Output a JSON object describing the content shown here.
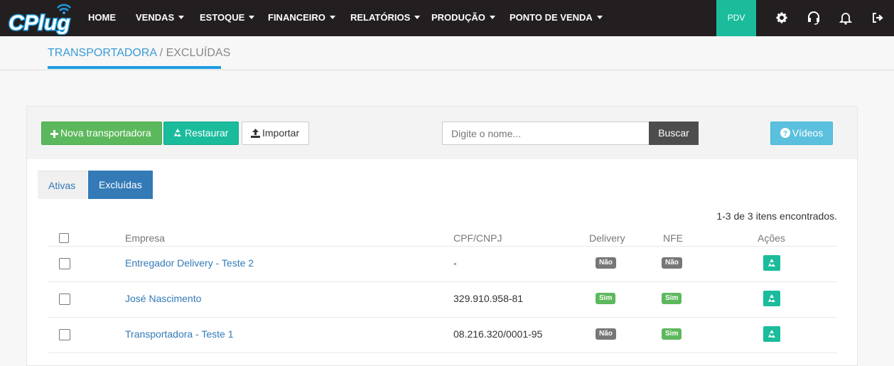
{
  "app": {
    "logo_text": "CPlug"
  },
  "nav": {
    "items": [
      {
        "label": "HOME",
        "dropdown": false
      },
      {
        "label": "VENDAS",
        "dropdown": true
      },
      {
        "label": "ESTOQUE",
        "dropdown": true
      },
      {
        "label": "FINANCEIRO",
        "dropdown": true
      },
      {
        "label": "RELATÓRIOS",
        "dropdown": true
      },
      {
        "label": "PRODUÇÃO",
        "dropdown": true
      },
      {
        "label": "PONTO DE VENDA",
        "dropdown": true
      }
    ],
    "pdv_label": "PDV",
    "icons": [
      "gear-icon",
      "headset-icon",
      "bell-icon",
      "logout-icon"
    ]
  },
  "breadcrumb": {
    "first": "TRANSPORTADORA",
    "separator": " / ",
    "current": "EXCLUÍDAS"
  },
  "toolbar": {
    "new_label": "Nova transportadora",
    "restore_label": "Restaurar",
    "import_label": "Importar",
    "search_placeholder": "Digite o nome...",
    "search_value": "",
    "search_button": "Buscar",
    "videos_label": "Vídeos"
  },
  "tabs": [
    {
      "label": "Ativas",
      "active": false
    },
    {
      "label": "Excluídas",
      "active": true
    }
  ],
  "result_count": "1-3 de 3 itens encontrados.",
  "table": {
    "headers": {
      "empresa": "Empresa",
      "cpf": "CPF/CNPJ",
      "delivery": "Delivery",
      "nfe": "NFE",
      "acoes": "Ações"
    },
    "rows": [
      {
        "empresa": "Entregador Delivery - Teste 2",
        "cpf": "-",
        "delivery": "Não",
        "nfe": "Não"
      },
      {
        "empresa": "José Nascimento",
        "cpf": "329.910.958-81",
        "delivery": "Sim",
        "nfe": "Sim"
      },
      {
        "empresa": "Transportadora - Teste 1",
        "cpf": "08.216.320/0001-95",
        "delivery": "Não",
        "nfe": "Sim"
      }
    ]
  },
  "colors": {
    "nav_bg": "#231f20",
    "pdv": "#1abc9c",
    "primary": "#337ab7",
    "success": "#5cb85c",
    "info": "#5bc0de",
    "muted": "#777777"
  }
}
